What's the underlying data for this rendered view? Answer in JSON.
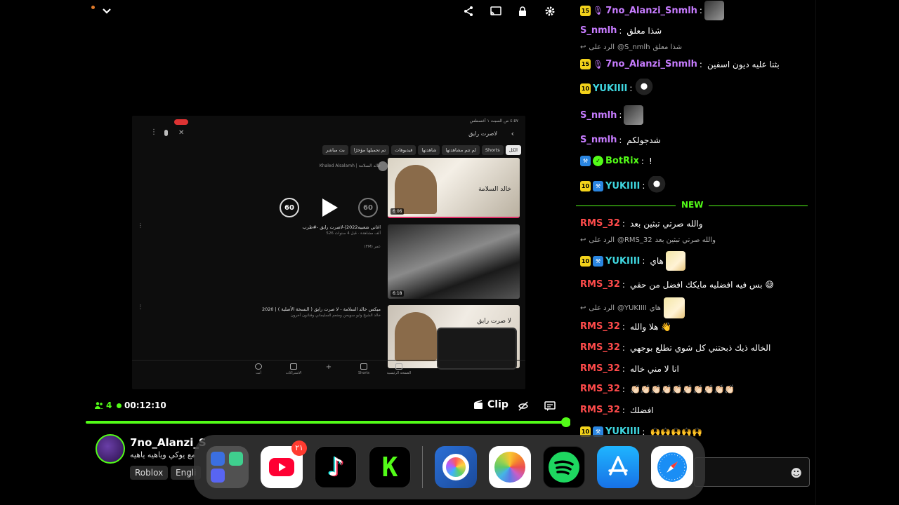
{
  "player": {
    "screen": {
      "status_time": "٤:٥٧ ص  السبت ١ أغسطس",
      "search_query": "لاصرت رايق",
      "chips": [
        "الكل",
        "Shorts",
        "لم تتم مشاهدتها",
        "شاهدتها",
        "فيديوهات",
        "تم تحميلها مؤخرًا",
        "بث مباشر"
      ],
      "channel_line": "Khaled Alsalamh | خالد السلامة",
      "results": [
        {
          "title": "اغاني شعبيه2022|-لاصرت رايق -#طرب",
          "meta": "526 ألف مشاهدة · قبل 4 سنوات",
          "extra": "(FM) عمر",
          "duration": "6:06",
          "caption": "خالد السلامة"
        },
        {
          "title": "",
          "meta": "",
          "extra": "",
          "duration": "6:18",
          "caption": ""
        },
        {
          "title": "ميكس خالد السلامة - لا صرت رايق ( النسخة الأصلية ) | 2020",
          "meta": "خالد الشيخ وابو سويحن ومنعم السليماني وفنانون آخرون",
          "extra": "",
          "duration": "",
          "caption": "لا صرت رايق"
        }
      ],
      "nav": [
        "الصفحة الرئيسية",
        "Shorts",
        "+",
        "الاشتراكات",
        "أنت"
      ]
    },
    "rewind_label": "60",
    "forward_label": "60",
    "viewers": "4",
    "uptime": "00:12:10",
    "clip_label": "Clip",
    "progress_pct": 100,
    "accent": "#53fc18"
  },
  "stream": {
    "streamer": "7no_Alanzi_S",
    "title": "مع يوكي وياهيه ياهيه",
    "tags": [
      "Roblox",
      "Engli"
    ]
  },
  "chat": {
    "new_label": "NEW",
    "messages": [
      {
        "user": "7no_Alanzi_Snmlh",
        "color": "#c77cff",
        "sub": "15",
        "mic": true,
        "text": ""
      },
      {
        "user": "S_nmlh",
        "color": "#c77cff",
        "text": "شذا معلق"
      },
      {
        "reply_to": "@S_nmlh",
        "reply_prefix": "الرد على",
        "reply_text": "شذا معلق"
      },
      {
        "user": "7no_Alanzi_Snmlh",
        "color": "#c77cff",
        "sub": "15",
        "mic": true,
        "text": "بثنا عليه ديون اسفين"
      },
      {
        "user": "YUKIIII",
        "color": "#3fd7e0",
        "sub": "10",
        "text": ""
      },
      {
        "user": "S_nmlh",
        "color": "#c77cff",
        "text": ""
      },
      {
        "user": "S_nmlh",
        "color": "#c77cff",
        "text": "شدجولكم"
      },
      {
        "user": "BotRix",
        "color": "#53fc18",
        "text": "!"
      },
      {
        "user": "YUKIIII",
        "color": "#3fd7e0",
        "sub": "10",
        "text": ""
      },
      {
        "user": "RMS_32",
        "color": "#ff4b4b",
        "text": "والله صرتي تبثين بعد"
      },
      {
        "reply_to": "@RMS_32",
        "reply_prefix": "الرد على",
        "reply_text": "والله صرتي تبثين بعد"
      },
      {
        "user": "YUKIIII",
        "color": "#3fd7e0",
        "sub": "10",
        "text": "هاي"
      },
      {
        "user": "RMS_32",
        "color": "#ff4b4b",
        "text": "بس فيه افضليه مايكك افضل من حقي 😅"
      },
      {
        "reply_to": "@YUKIIII",
        "reply_prefix": "الرد على",
        "reply_text": "هاي"
      },
      {
        "user": "RMS_32",
        "color": "#ff4b4b",
        "text": "هلا والله 👋"
      },
      {
        "user": "RMS_32",
        "color": "#ff4b4b",
        "text": "الخاله ذيك ذبحتني كل شوي تطلع بوجهي"
      },
      {
        "user": "RMS_32",
        "color": "#ff4b4b",
        "text": "انا لا مني خاله"
      },
      {
        "user": "RMS_32",
        "color": "#ff4b4b",
        "text": "👏🏻👏🏻👏🏻👏🏻👏🏻👏🏻👏🏻👏🏻👏🏻👏🏻"
      },
      {
        "user": "RMS_32",
        "color": "#ff4b4b",
        "text": "افضلك"
      },
      {
        "user": "YUKIIII",
        "color": "#3fd7e0",
        "sub": "10",
        "text": "🙌🙌🙌🙌🙌"
      }
    ]
  },
  "dock": {
    "apps": [
      {
        "name": "App Library",
        "icon": "folder-icon"
      },
      {
        "name": "YouTube",
        "icon": "youtube-icon",
        "badge": "٢١"
      },
      {
        "name": "TikTok",
        "icon": "tiktok-icon"
      },
      {
        "name": "Kick",
        "icon": "kick-icon"
      },
      {
        "name": "ibisPaint",
        "icon": "ibispaint-icon"
      },
      {
        "name": "Photos",
        "icon": "photos-icon"
      },
      {
        "name": "Spotify",
        "icon": "spotify-icon"
      },
      {
        "name": "App Store",
        "icon": "appstore-icon"
      },
      {
        "name": "Safari",
        "icon": "safari-icon"
      }
    ]
  }
}
